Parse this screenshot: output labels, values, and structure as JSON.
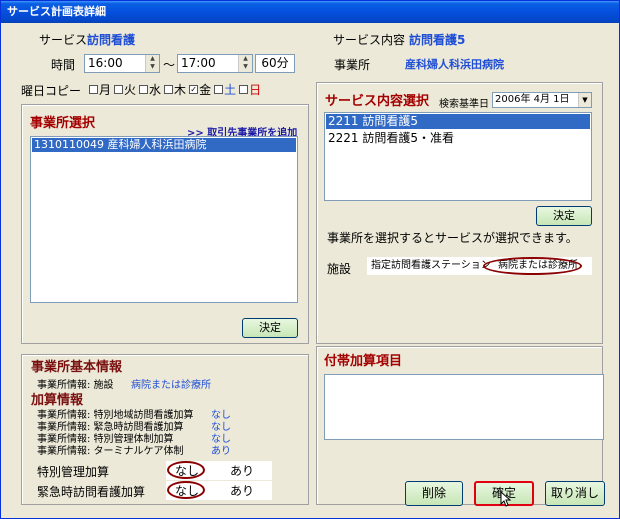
{
  "window": {
    "title": "サービス計画表詳細"
  },
  "service": {
    "label": "サービス",
    "value": "訪問看護"
  },
  "service_content": {
    "label": "サービス内容",
    "value": "訪問看護5"
  },
  "office": {
    "label": "事業所",
    "value": "産科婦人科浜田病院"
  },
  "time": {
    "label": "時間",
    "start": "16:00",
    "separator": "〜",
    "end": "17:00",
    "duration": "60分"
  },
  "weekday_copy": {
    "label": "曜日コピー",
    "days": [
      {
        "label": "月",
        "checked": false,
        "color": "#000000"
      },
      {
        "label": "火",
        "checked": false,
        "color": "#000000"
      },
      {
        "label": "水",
        "checked": false,
        "color": "#000000"
      },
      {
        "label": "木",
        "checked": false,
        "color": "#000000"
      },
      {
        "label": "金",
        "checked": true,
        "color": "#000000"
      },
      {
        "label": "土",
        "checked": false,
        "color": "#1f4ed6"
      },
      {
        "label": "日",
        "checked": false,
        "color": "#cc0000"
      }
    ]
  },
  "office_select": {
    "heading": "事業所選択",
    "add_link": ">> 取引先事業所を追加",
    "items": [
      "1310110049 産科婦人科浜田病院"
    ],
    "confirm_label": "決定"
  },
  "service_select": {
    "heading": "サービス内容選択",
    "search_date_label": "検索基準日",
    "search_date_value": "2006年 4月 1日",
    "items": [
      "2211 訪問看護5",
      "2221 訪問看護5・准看"
    ],
    "confirm_label": "決定",
    "note": "事業所を選択するとサービスが選択できます。",
    "facility_label": "施設",
    "facility_value1": "指定訪問看護ステーション",
    "facility_value2": "病院または診療所"
  },
  "office_info": {
    "heading": "事業所基本情報",
    "facility_row": {
      "label": "事業所情報: 施設",
      "value": "病院または診療所"
    },
    "addition_heading": "加算情報",
    "rows": [
      {
        "label": "事業所情報: 特別地域訪問看護加算",
        "value": "なし"
      },
      {
        "label": "事業所情報: 緊急時訪問看護加算",
        "value": "なし"
      },
      {
        "label": "事業所情報: 特別管理体制加算",
        "value": "なし"
      },
      {
        "label": "事業所情報: ターミナルケア体制",
        "value": "あり"
      }
    ],
    "toggles": [
      {
        "label": "特別管理加算",
        "opt_off": "なし",
        "opt_on": "あり"
      },
      {
        "label": "緊急時訪問看護加算",
        "opt_off": "なし",
        "opt_on": "あり"
      }
    ]
  },
  "extra_items": {
    "heading": "付帯加算項目"
  },
  "buttons": {
    "delete": "削除",
    "confirm": "確定",
    "cancel": "取り消し"
  }
}
